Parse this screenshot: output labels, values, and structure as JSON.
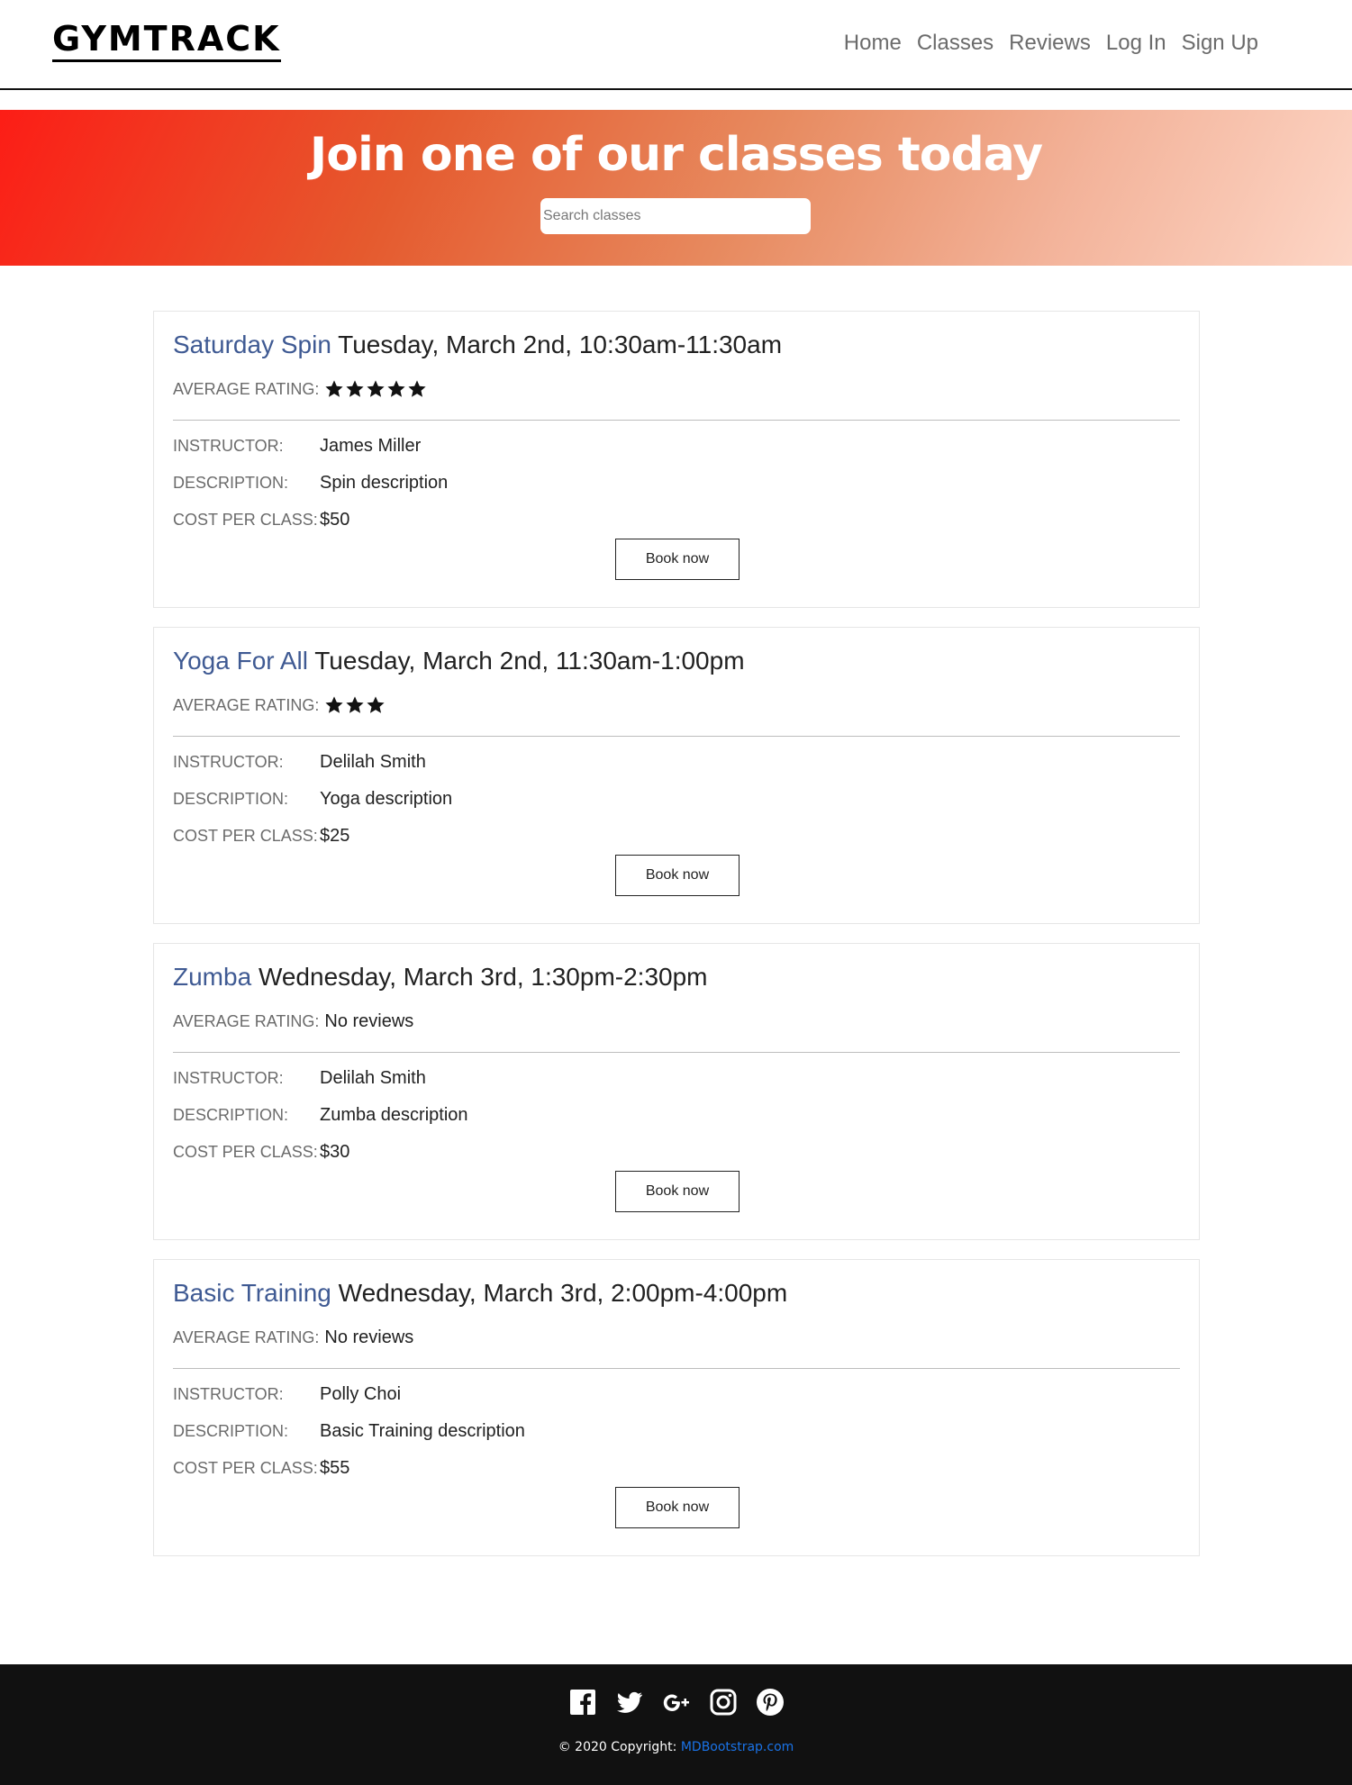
{
  "brand": {
    "logo": "GYMTRACK"
  },
  "nav": {
    "items": [
      "Home",
      "Classes",
      "Reviews",
      "Log In",
      "Sign Up"
    ]
  },
  "hero": {
    "title": "Join one of our classes today",
    "search_placeholder": "Search classes"
  },
  "labels": {
    "average_rating": "AVERAGE RATING:",
    "instructor": "INSTRUCTOR:",
    "description": "DESCRIPTION:",
    "cost": "COST PER CLASS:",
    "book": "Book now"
  },
  "classes": [
    {
      "name": "Saturday Spin",
      "time": "Tuesday, March 2nd, 10:30am-11:30am",
      "rating_stars": 5,
      "rating_text": "",
      "instructor": "James Miller",
      "description": "Spin description",
      "cost": "$50"
    },
    {
      "name": "Yoga For All",
      "time": "Tuesday, March 2nd, 11:30am-1:00pm",
      "rating_stars": 3,
      "rating_text": "",
      "instructor": "Delilah Smith",
      "description": "Yoga description",
      "cost": "$25"
    },
    {
      "name": "Zumba",
      "time": "Wednesday, March 3rd, 1:30pm-2:30pm",
      "rating_stars": 0,
      "rating_text": "No reviews",
      "instructor": "Delilah Smith",
      "description": "Zumba description",
      "cost": "$30"
    },
    {
      "name": "Basic Training",
      "time": "Wednesday, March 3rd, 2:00pm-4:00pm",
      "rating_stars": 0,
      "rating_text": "No reviews",
      "instructor": "Polly Choi",
      "description": "Basic Training description",
      "cost": "$55"
    }
  ],
  "footer": {
    "social_icons": [
      "facebook-icon",
      "twitter-icon",
      "google-plus-icon",
      "instagram-icon",
      "pinterest-icon"
    ],
    "copyright_prefix": "© 2020 Copyright:",
    "copyright_link": "MDBootstrap.com"
  },
  "colors": {
    "class_name": "#3f5a93",
    "hero_gradient_start": "#fc1d16",
    "hero_gradient_end": "#fdd6c6",
    "footer_bg": "#111111",
    "link": "#1a73e8"
  }
}
